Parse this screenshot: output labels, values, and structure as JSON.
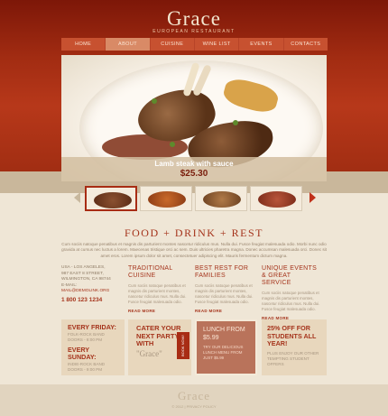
{
  "brand": {
    "name": "Grace",
    "subtitle": "EUROPEAN RESTAURANT"
  },
  "nav": [
    {
      "label": "HOME",
      "active": false
    },
    {
      "label": "ABOUT",
      "active": true
    },
    {
      "label": "CUISINE",
      "active": false
    },
    {
      "label": "WINE LIST",
      "active": false
    },
    {
      "label": "EVENTS",
      "active": false
    },
    {
      "label": "CONTACTS",
      "active": false
    }
  ],
  "hero": {
    "caption_title": "Lamb steak with sauce",
    "caption_price": "$25.30"
  },
  "colors": {
    "accent": "#a5341c",
    "header": "#a22c12",
    "background": "#efe6d6"
  },
  "tagline": "FOOD + DRINK + REST",
  "intro": "Cum sociis natoque penatibus et magnis dis parturient montes nascetur ridiculus mus. Nulla dui. Fusce feugiat malesuada odio. Morbi nunc odio gravida at cursus nec luctus a lorem. Maecenas tristique orci ac sem. Duis ultricies pharetra magna. Donec accumsan malesuada orci. Donec sit amet eros. Lorem ipsum dolor sit amet, consectetuer adipiscing elit. Mauris fermentum dictum magna.",
  "address": {
    "line1": "USA - LOS ANGELES,",
    "line2": "987 EAST 8 STREET,",
    "line3": "WILMINGTON, CA 98744",
    "email_label": "E-MAIL:",
    "email": "MAIL@DEMOLINK.ORG",
    "phone": "1 800 123 1234"
  },
  "columns": [
    {
      "title": "TRADITIONAL CUISINE",
      "text": "Cum sociis natoque penatibus et magnis dis parturient montes, nascetur ridiculus mus. Nulla dui. Fusce feugiat malesuada odio.",
      "more": "READ MORE"
    },
    {
      "title": "BEST REST FOR FAMILIES",
      "text": "Cum sociis natoque penatibus et magnis dis parturient montes, nascetur ridiculus mus. Nulla dui. Fusce feugiat malesuada odio.",
      "more": "READ MORE"
    },
    {
      "title": "UNIQUE EVENTS & GREAT SERVICE",
      "text": "Cum sociis natoque penatibus et magnis dis parturient montes, nascetur ridiculus mus. Nulla dui. Fusce feugiat malesuada odio.",
      "more": "READ MORE"
    }
  ],
  "promos": {
    "events": {
      "friday_title": "EVERY FRIDAY:",
      "friday_band": "FOLK-ROCK BAND",
      "friday_time": "DOORS - 8:00 PM",
      "sunday_title": "EVERY SUNDAY:",
      "sunday_band": "INDIE-ROCK BAND",
      "sunday_time": "DOORS - 9:00 PM"
    },
    "party": {
      "line1": "CATER YOUR NEXT PARTY WITH",
      "line2": "\"Grace\"",
      "badge": "BOOK NOW!"
    },
    "lunch": {
      "title": "LUNCH FROM $5.99",
      "text": "TRY OUR DELICIOUS LUNCH MENU FROM JUST $5.99"
    },
    "students": {
      "title": "25% OFF FOR STUDENTS ALL YEAR!",
      "text": "PLUS ENJOY OUR OTHER TEMPTING STUDENT OFFERS"
    }
  },
  "footer": {
    "logo": "Grace",
    "copy": "© 2012 | PRIVACY POLICY"
  }
}
